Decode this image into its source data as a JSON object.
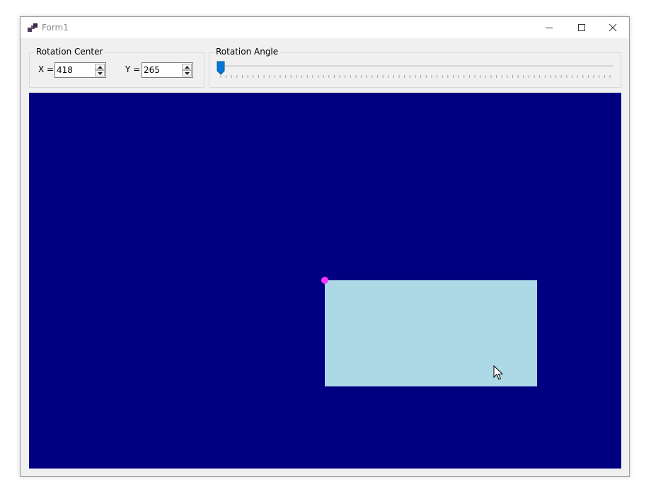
{
  "window": {
    "title": "Form1",
    "controls": {
      "minimize": "minimize",
      "maximize": "maximize",
      "close": "close"
    }
  },
  "rotation_center": {
    "group_label": "Rotation Center",
    "x_label": "X =",
    "x_value": "418",
    "y_label": "Y =",
    "y_value": "265"
  },
  "rotation_angle": {
    "group_label": "Rotation Angle",
    "slider_value_fraction": 0
  },
  "canvas": {
    "background_color": "#000080",
    "rectangle_color": "#add8e6",
    "center_marker_color": "#ff33ff"
  },
  "icons": [
    "app-icon",
    "minimize-icon",
    "maximize-icon",
    "close-icon",
    "spin-up-icon",
    "spin-down-icon",
    "mouse-cursor-icon"
  ]
}
